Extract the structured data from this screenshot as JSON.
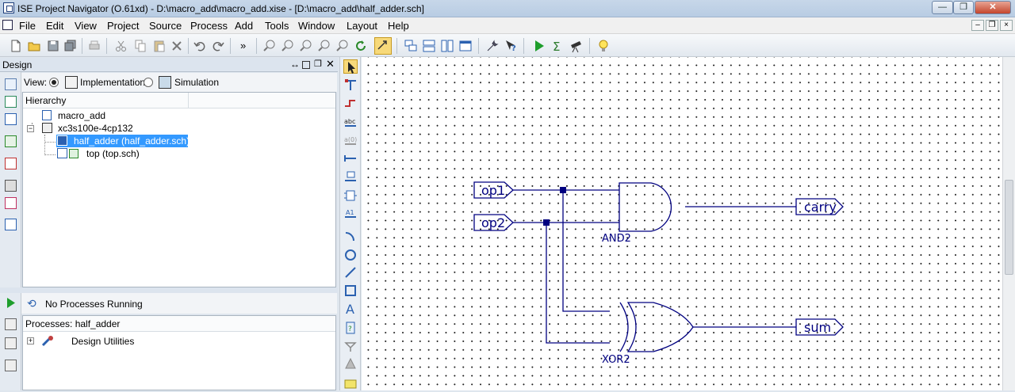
{
  "window": {
    "title": "ISE Project Navigator (O.61xd) - D:\\macro_add\\macro_add.xise - [D:\\macro_add\\half_adder.sch]"
  },
  "menubar": {
    "items": [
      "File",
      "Edit",
      "View",
      "Project",
      "Source",
      "Process",
      "Add",
      "Tools",
      "Window",
      "Layout",
      "Help"
    ]
  },
  "design_panel": {
    "title": "Design",
    "view_label": "View:",
    "view_options": [
      "Implementation",
      "Simulation"
    ],
    "selected_view": "Implementation",
    "hierarchy_header": "Hierarchy",
    "tree": [
      {
        "label": "macro_add",
        "icon": "project-icon"
      },
      {
        "label": "xc3s100e-4cp132",
        "icon": "chip-icon"
      },
      {
        "label": "half_adder (half_adder.sch)",
        "icon": "schematic-icon",
        "selected": true
      },
      {
        "label": "top (top.sch)",
        "icon": "schematic-icon"
      }
    ]
  },
  "processes_panel": {
    "status": "No Processes Running",
    "header": "Processes: half_adder",
    "items": [
      {
        "label": "Design Utilities",
        "icon": "tools-icon"
      }
    ]
  },
  "schematic": {
    "inputs": [
      "op1",
      "op2"
    ],
    "outputs": [
      "carry",
      "sum"
    ],
    "gates": [
      "AND2",
      "XOR2"
    ],
    "wire_color": "#000080"
  },
  "colors": {
    "selection": "#3399ff",
    "wire": "#000080"
  }
}
